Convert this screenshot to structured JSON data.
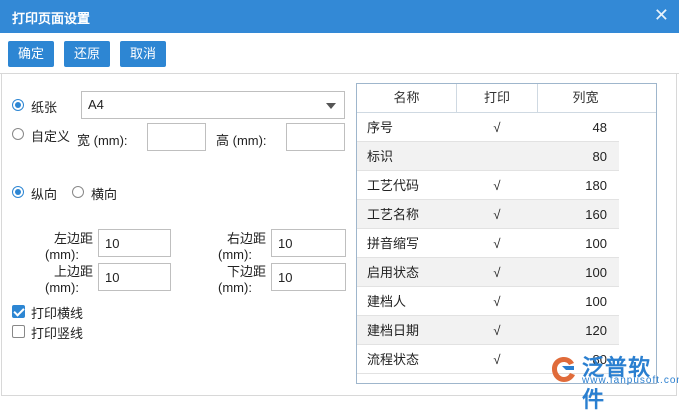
{
  "dialog": {
    "title": "打印页面设置",
    "close_glyph": "✕"
  },
  "toolbar": {
    "confirm": "确定",
    "restore": "还原",
    "cancel": "取消"
  },
  "paper": {
    "paper_label": "纸张",
    "paper_value": "A4",
    "custom_label": "自定义",
    "width_label": "宽 (mm):",
    "width_value": "",
    "height_label": "高 (mm):",
    "height_value": ""
  },
  "orientation": {
    "portrait": "纵向",
    "landscape": "横向"
  },
  "margins": {
    "left_label_1": "左边距",
    "left_label_2": "(mm):",
    "left_value": "10",
    "right_label_1": "右边距",
    "right_label_2": "(mm):",
    "right_value": "10",
    "top_label_1": "上边距",
    "top_label_2": "(mm):",
    "top_value": "10",
    "bottom_label_1": "下边距",
    "bottom_label_2": "(mm):",
    "bottom_value": "10"
  },
  "options": {
    "print_hlines": "打印横线",
    "print_vlines": "打印竖线"
  },
  "table": {
    "headers": [
      "名称",
      "打印",
      "列宽"
    ],
    "rows": [
      {
        "name": "序号",
        "print": "√",
        "width": "48"
      },
      {
        "name": "标识",
        "print": "",
        "width": "80"
      },
      {
        "name": "工艺代码",
        "print": "√",
        "width": "180"
      },
      {
        "name": "工艺名称",
        "print": "√",
        "width": "160"
      },
      {
        "name": "拼音缩写",
        "print": "√",
        "width": "100"
      },
      {
        "name": "启用状态",
        "print": "√",
        "width": "100"
      },
      {
        "name": "建档人",
        "print": "√",
        "width": "100"
      },
      {
        "name": "建档日期",
        "print": "√",
        "width": "120"
      },
      {
        "name": "流程状态",
        "print": "√",
        "width": "80"
      }
    ]
  },
  "watermark": {
    "brand": "泛普软件",
    "url": "www.fanpusoft.com"
  },
  "colors": {
    "title_bar": "#3389d6",
    "button": "#2d86d3",
    "accent": "#2a7fd0"
  }
}
